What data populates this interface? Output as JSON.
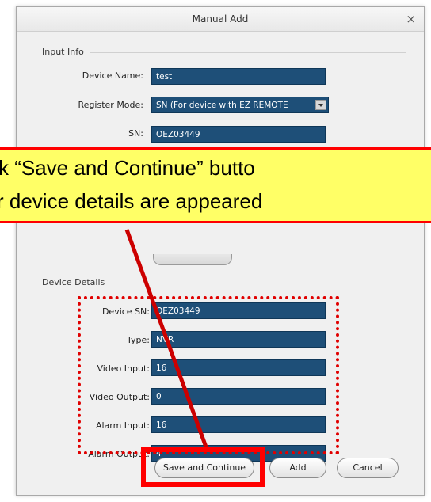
{
  "dialog": {
    "title": "Manual Add",
    "close_glyph": "×"
  },
  "input_info": {
    "section_label": "Input Info",
    "device_name": {
      "label": "Device Name:",
      "value": "test"
    },
    "register_mode": {
      "label": "Register Mode:",
      "value": "SN (For device with EZ REMOTE"
    },
    "sn": {
      "label": "SN:",
      "value": "OEZ03449"
    }
  },
  "device_details": {
    "section_label": "Device Details",
    "rows": [
      {
        "label": "Device SN:",
        "value": "OEZ03449"
      },
      {
        "label": "Type:",
        "value": "NVR"
      },
      {
        "label": "Video Input:",
        "value": "16"
      },
      {
        "label": "Video Output:",
        "value": "0"
      },
      {
        "label": "Alarm Input:",
        "value": "16"
      },
      {
        "label": "Alarm Output:",
        "value": "4"
      }
    ]
  },
  "buttons": {
    "save_continue": "Save and Continue",
    "add": "Add",
    "cancel": "Cancel"
  },
  "annotation": {
    "line1": "k “Save and Continue” butto",
    "line2": "r device details are appeared",
    "colors": {
      "callout_bg": "#ffff66",
      "highlight": "#ff0000"
    }
  },
  "theme": {
    "field_bg": "#1e4f78",
    "dialog_bg": "#f0f0f0"
  }
}
